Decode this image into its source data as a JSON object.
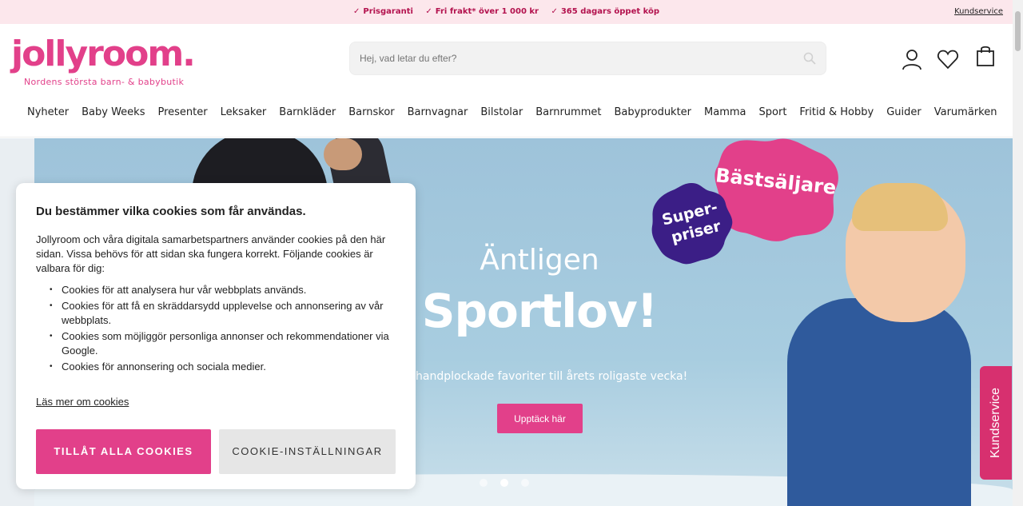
{
  "topbar": {
    "usps": [
      "Prisgaranti",
      "Fri frakt* över 1 000 kr",
      "365 dagars öppet köp"
    ],
    "kundservice": "Kundservice"
  },
  "header": {
    "logo": "jollyroom.",
    "tagline": "Nordens största barn- & babybutik",
    "search_placeholder": "Hej, vad letar du efter?",
    "icons": [
      "user-icon",
      "heart-icon",
      "bag-icon"
    ]
  },
  "nav": [
    "Nyheter",
    "Baby Weeks",
    "Presenter",
    "Leksaker",
    "Barnkläder",
    "Barnskor",
    "Barnvagnar",
    "Bilstolar",
    "Barnrummet",
    "Babyprodukter",
    "Mamma",
    "Sport",
    "Fritid & Hobby",
    "Guider",
    "Varumärken"
  ],
  "hero": {
    "pre": "Äntligen",
    "title": "Sportlov!",
    "subtitle": "ck handplockade favoriter till årets roligaste vecka!",
    "cta": "Upptäck här",
    "badge_best": "Bästsäljare",
    "badge_super": [
      "Super-",
      "priser"
    ],
    "slide_count": 3,
    "active_slide": 2
  },
  "side_tab": "Kundservice",
  "cookie": {
    "title": "Du bestämmer vilka cookies som får användas.",
    "intro": "Jollyroom och våra digitala samarbetspartners använder cookies på den här sidan. Vissa behövs för att sidan ska fungera korrekt. Följande cookies är valbara för dig:",
    "items": [
      "Cookies för att analysera hur vår webbplats används.",
      "Cookies för att få en skräddarsydd upplevelse och annonsering av vår webbplats.",
      "Cookies som möjliggör personliga annonser och rekommendationer via Google.",
      "Cookies för annonsering och sociala medier."
    ],
    "read_more": "Läs mer om cookies",
    "allow_all": "TILLÅT ALLA COOKIES",
    "settings": "COOKIE-INSTÄLLNINGAR"
  },
  "colors": {
    "brand_pink": "#e2408a",
    "topbar_bg": "#fce7ec",
    "badge_purple": "#3b1e86"
  }
}
